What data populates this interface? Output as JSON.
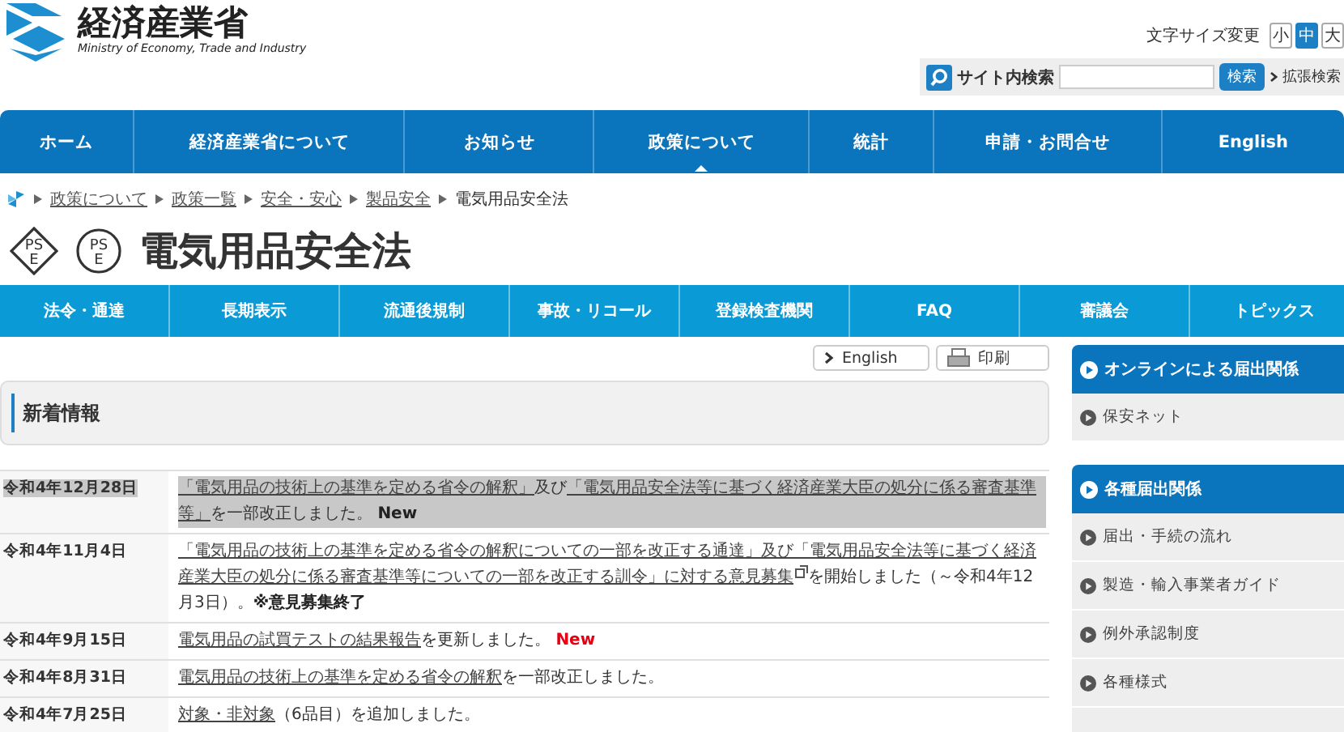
{
  "logo": {
    "name": "経済産業省",
    "subtitle": "Ministry of Economy, Trade and Industry"
  },
  "font_size": {
    "label": "文字サイズ変更",
    "options": [
      {
        "label": "小",
        "selected": false
      },
      {
        "label": "中",
        "selected": true
      },
      {
        "label": "大",
        "selected": false
      }
    ]
  },
  "search": {
    "label": "サイト内検索",
    "button": "検索",
    "advanced": "拡張検索"
  },
  "main_nav": [
    {
      "label": "ホーム",
      "selected": false
    },
    {
      "label": "経済産業省について",
      "selected": false
    },
    {
      "label": "お知らせ",
      "selected": false
    },
    {
      "label": "政策について",
      "selected": true
    },
    {
      "label": "統計",
      "selected": false
    },
    {
      "label": "申請・お問合せ",
      "selected": false
    },
    {
      "label": "English",
      "selected": false
    }
  ],
  "breadcrumb": [
    {
      "label": "政策について",
      "kind": "link"
    },
    {
      "label": "政策一覧",
      "kind": "link"
    },
    {
      "label": "安全・安心",
      "kind": "link"
    },
    {
      "label": "製品安全",
      "kind": "link"
    },
    {
      "label": "電気用品安全法",
      "kind": "current"
    }
  ],
  "pse_marks": [
    {
      "kind": "diamond",
      "top": "PS",
      "bottom": "E"
    },
    {
      "kind": "circle",
      "top": "PS",
      "bottom": "E"
    }
  ],
  "page_title": "電気用品安全法",
  "sub_nav": [
    "法令・通達",
    "長期表示",
    "流通後規制",
    "事故・リコール",
    "登録検査機関",
    "FAQ",
    "審議会",
    "トピックス"
  ],
  "tools": [
    {
      "label": "English",
      "kind": "language"
    },
    {
      "label": "印刷",
      "kind": "print"
    }
  ],
  "news": {
    "title": "新着情報",
    "rows": [
      {
        "date": "令和4年12月28日",
        "highlighted": true,
        "body": [
          {
            "kind": "link",
            "text": "「電気用品の技術上の基準を定める省令の解釈」"
          },
          {
            "kind": "text",
            "text": "及び"
          },
          {
            "kind": "link",
            "text": "「電気用品安全法等に基づく経済産業大臣の処分に係る審査基準等」"
          },
          {
            "kind": "text",
            "text": "を一部改正しました。 "
          },
          {
            "kind": "strong",
            "text": "New"
          }
        ]
      },
      {
        "date": "令和4年11月4日",
        "highlighted": false,
        "body": [
          {
            "kind": "link",
            "text": "「電気用品の技術上の基準を定める省令の解釈についての一部を改正する通達」及び「電気用品安全法等に基づく経済産業大臣の処分に係る審査基準等についての一部を改正する訓令」に対する意見募集",
            "external": true
          },
          {
            "kind": "text",
            "text": "を開始しました（～令和4年12月3日）。"
          },
          {
            "kind": "strong",
            "text": "※意見募集終了"
          }
        ]
      },
      {
        "date": "令和4年9月15日",
        "highlighted": false,
        "body": [
          {
            "kind": "link",
            "text": "電気用品の試買テストの結果報告"
          },
          {
            "kind": "text",
            "text": "を更新しました。 "
          },
          {
            "kind": "alert",
            "text": "New"
          }
        ]
      },
      {
        "date": "令和4年8月31日",
        "highlighted": false,
        "body": [
          {
            "kind": "link",
            "text": "電気用品の技術上の基準を定める省令の解釈"
          },
          {
            "kind": "text",
            "text": "を一部改正しました。"
          }
        ]
      },
      {
        "date": "令和4年7月25日",
        "highlighted": false,
        "body": [
          {
            "kind": "link",
            "text": "対象・非対象"
          },
          {
            "kind": "text",
            "text": "（6品目）を追加しました。"
          }
        ]
      }
    ]
  },
  "sidebar": [
    {
      "title": "オンラインによる届出関係",
      "items": [
        "保安ネット"
      ]
    },
    {
      "title": "各種届出関係",
      "items": [
        "届出・手続の流れ",
        "製造・輸入事業者ガイド",
        "例外承認制度",
        "各種様式"
      ]
    }
  ]
}
